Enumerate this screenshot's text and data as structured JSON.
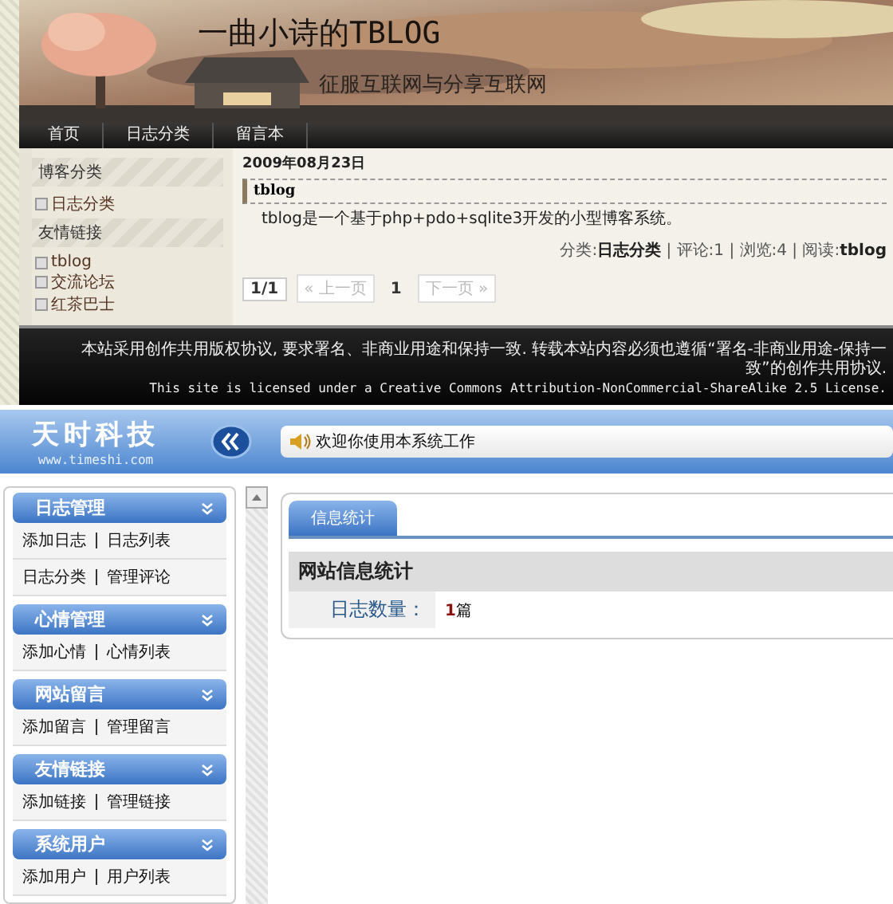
{
  "blog": {
    "title": "一曲小诗的TBLOG",
    "subtitle": "征服互联网与分享互联网",
    "nav": [
      {
        "label": "首页"
      },
      {
        "label": "日志分类"
      },
      {
        "label": "留言本"
      }
    ],
    "sidebar": [
      {
        "heading": "博客分类",
        "items": [
          "日志分类"
        ]
      },
      {
        "heading": "友情链接",
        "items": [
          "tblog",
          "交流论坛",
          "红茶巴士"
        ]
      }
    ],
    "post": {
      "date": "2009年08月23日",
      "title": "tblog",
      "body": "tblog是一个基于php+pdo+sqlite3开发的小型博客系统。",
      "meta": "分类:**日志分类** | 评论:1 | 浏览:4 | 阅读:**tblog**"
    },
    "pagination": [
      {
        "label": "1/1",
        "kind": "count",
        "disabled": false
      },
      {
        "label": "« 上一页",
        "kind": "button",
        "disabled": true
      },
      {
        "label": "1",
        "kind": "page",
        "disabled": false
      },
      {
        "label": "下一页 »",
        "kind": "button",
        "disabled": true
      }
    ],
    "footer": [
      "本站采用创作共用版权协议, 要求署名、非商业用途和保持一致. 转载本站内容必须也遵循“署名-非商业用途-保持一致”的创作共用协议.",
      "This site is licensed under a Creative Commons Attribution-NonCommercial-ShareAlike 2.5 License."
    ]
  },
  "admin": {
    "logo": "天时科技",
    "logo_url": "www.timeshi.com",
    "welcome": "欢迎你使用本系统工作",
    "menu": [
      {
        "title": "日志管理",
        "rows": [
          [
            "添加日志",
            "日志列表"
          ],
          [
            "日志分类",
            "管理评论"
          ]
        ]
      },
      {
        "title": "心情管理",
        "rows": [
          [
            "添加心情",
            "心情列表"
          ]
        ]
      },
      {
        "title": "网站留言",
        "rows": [
          [
            "添加留言",
            "管理留言"
          ]
        ]
      },
      {
        "title": "友情链接",
        "rows": [
          [
            "添加链接",
            "管理链接"
          ]
        ]
      },
      {
        "title": "系统用户",
        "rows": [
          [
            "添加用户",
            "用户列表"
          ]
        ]
      }
    ],
    "tabs": [
      {
        "label": "信息统计",
        "selected": true
      }
    ],
    "stats": {
      "heading": "网站信息统计",
      "rows": [
        {
          "label": "日志数量：",
          "value": "**1**篇"
        }
      ]
    }
  }
}
